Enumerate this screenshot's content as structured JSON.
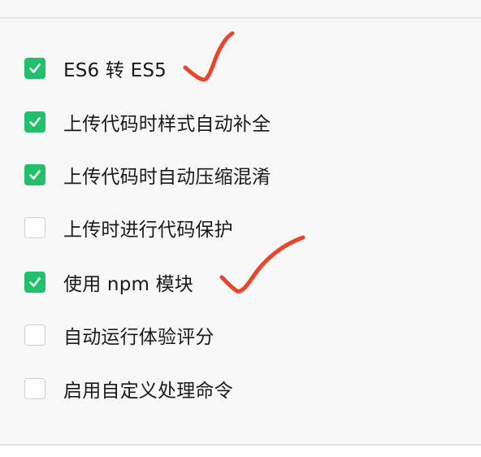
{
  "settings": {
    "options": [
      {
        "label": "ES6 转 ES5",
        "checked": true
      },
      {
        "label": "上传代码时样式自动补全",
        "checked": true
      },
      {
        "label": "上传代码时自动压缩混淆",
        "checked": true
      },
      {
        "label": "上传时进行代码保护",
        "checked": false
      },
      {
        "label": "使用 npm 模块",
        "checked": true
      },
      {
        "label": "自动运行体验评分",
        "checked": false
      },
      {
        "label": "启用自定义处理命令",
        "checked": false
      }
    ]
  },
  "colors": {
    "checked": "#22c06b",
    "annotation": "#e8452c"
  }
}
